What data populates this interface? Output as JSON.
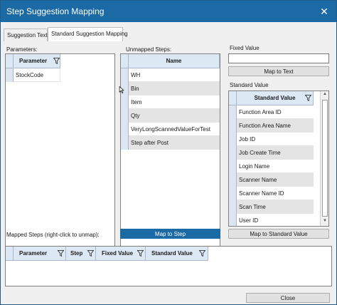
{
  "window": {
    "title": "Step Suggestion Mapping"
  },
  "tabs": [
    "Suggestion Text",
    "Standard Suggestion Mapping"
  ],
  "parameters": {
    "label": "Parameters:",
    "header": "Parameter",
    "rows": [
      "StockCode"
    ]
  },
  "unmapped": {
    "label": "Unmapped Steps:",
    "header": "Name",
    "rows": [
      "WH",
      "Bin",
      "Item",
      "Qty",
      "VeryLongScannedValueForTest",
      "Step after Post"
    ],
    "button": "Map to Step"
  },
  "fixed_value": {
    "label": "Fixed Value",
    "value": "",
    "button": "Map to Text"
  },
  "standard_value": {
    "label": "Standard Value",
    "header": "Standard Value",
    "rows": [
      "Function Area ID",
      "Function Area Name",
      "Job ID",
      "Job Create Time",
      "Login Name",
      "Scanner Name",
      "Scanner Name ID",
      "Scan Time",
      "User ID"
    ],
    "button": "Map to Standard Value"
  },
  "mapped": {
    "label": "Mapped Steps (right-click to unmap):",
    "headers": [
      "Parameter",
      "Step",
      "Fixed Value",
      "Standard Value"
    ]
  },
  "footer": {
    "close": "Close"
  },
  "colors": {
    "accent": "#1b6aa5",
    "header_bg": "#dde8f5",
    "alt_row": "#e4e4e4"
  }
}
